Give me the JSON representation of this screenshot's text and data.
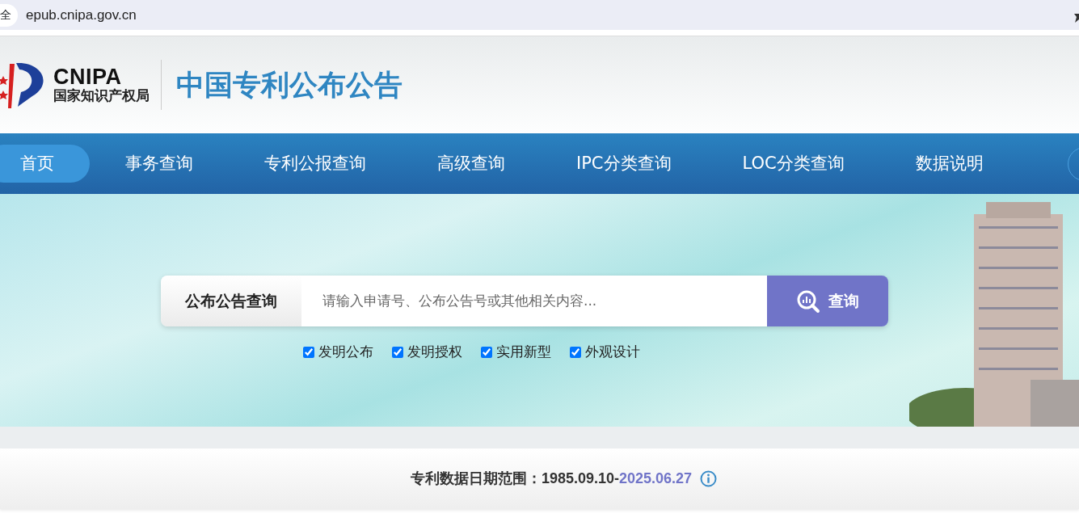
{
  "browser": {
    "security_chip": "全",
    "url": "epub.cnipa.gov.cn"
  },
  "header": {
    "logo_abbr": "CNIPA",
    "logo_name": "国家知识产权局",
    "site_title": "中国专利公布公告"
  },
  "nav": [
    {
      "label": "首页",
      "selected": true
    },
    {
      "label": "事务查询",
      "selected": false
    },
    {
      "label": "专利公报查询",
      "selected": false
    },
    {
      "label": "高级查询",
      "selected": false
    },
    {
      "label": "IPC分类查询",
      "selected": false
    },
    {
      "label": "LOC分类查询",
      "selected": false
    },
    {
      "label": "数据说明",
      "selected": false
    }
  ],
  "search": {
    "label": "公布公告查询",
    "placeholder": "请输入申请号、公布公告号或其他相关内容...",
    "button": "查询"
  },
  "filters": [
    {
      "label": "发明公布",
      "checked": true
    },
    {
      "label": "发明授权",
      "checked": true
    },
    {
      "label": "实用新型",
      "checked": true
    },
    {
      "label": "外观设计",
      "checked": true
    }
  ],
  "date_range": {
    "label": "专利数据日期范围：",
    "start": "1985.09.10",
    "separator": "-",
    "end": "2025.06.27"
  }
}
